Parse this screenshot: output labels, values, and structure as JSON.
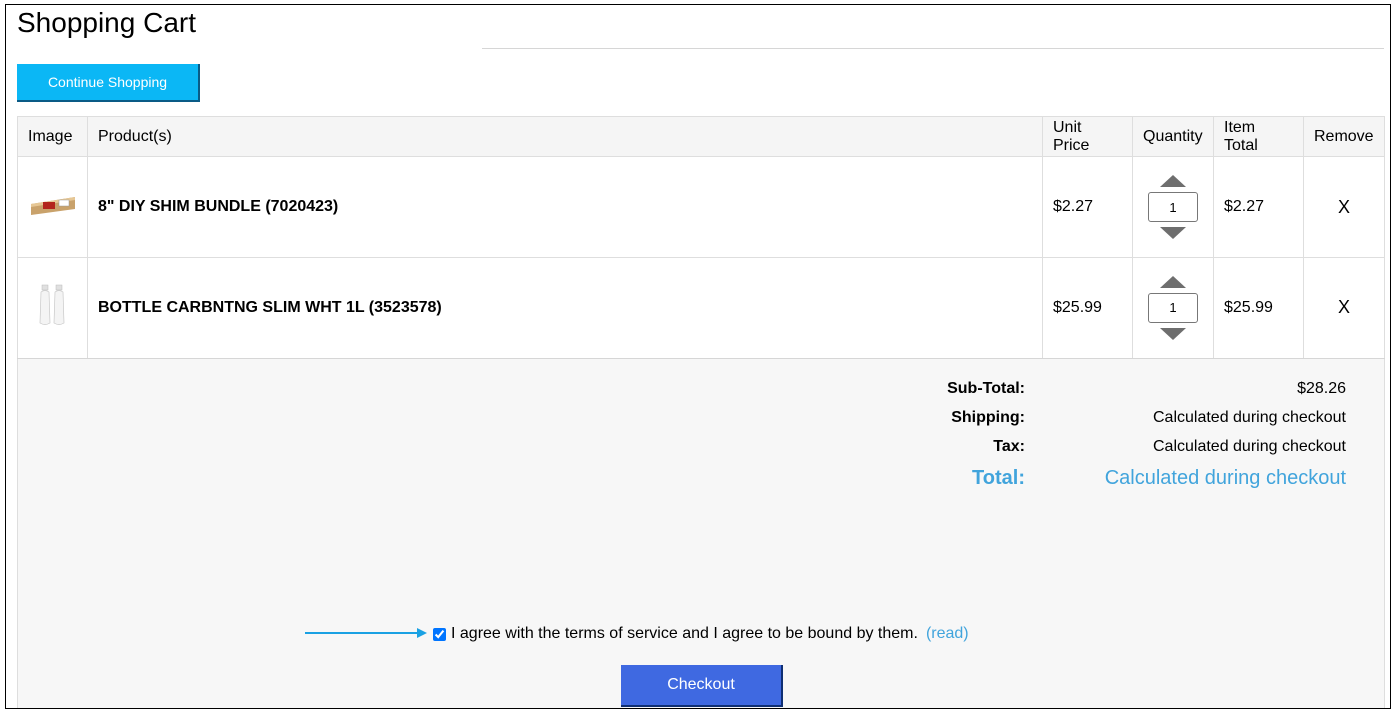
{
  "page": {
    "title": "Shopping Cart"
  },
  "actions": {
    "continue_label": "Continue Shopping",
    "checkout_label": "Checkout"
  },
  "table": {
    "headers": {
      "image": "Image",
      "product": "Product(s)",
      "unit_price": "Unit Price",
      "quantity": "Quantity",
      "item_total": "Item Total",
      "remove": "Remove"
    },
    "rows": [
      {
        "name": "8\" DIY SHIM BUNDLE (7020423)",
        "unit_price": "$2.27",
        "quantity": "1",
        "item_total": "$2.27",
        "remove": "X",
        "image_icon": "shim-bundle-thumbnail"
      },
      {
        "name": "BOTTLE CARBNTNG SLIM WHT 1L (3523578)",
        "unit_price": "$25.99",
        "quantity": "1",
        "item_total": "$25.99",
        "remove": "X",
        "image_icon": "bottles-thumbnail"
      }
    ]
  },
  "summary": {
    "subtotal_label": "Sub-Total:",
    "subtotal_value": "$28.26",
    "shipping_label": "Shipping:",
    "shipping_value": "Calculated during checkout",
    "tax_label": "Tax:",
    "tax_value": "Calculated during checkout",
    "total_label": "Total:",
    "total_value": "Calculated during checkout"
  },
  "terms": {
    "text": "I agree with the terms of service and I agree to be bound by them.",
    "read_label": "(read)",
    "checked": true
  },
  "colors": {
    "continue_button": "#0bb7f5",
    "checkout_button": "#3f69e1",
    "accent_total": "#41a4dc",
    "annotation_arrow": "#1aa1e3"
  }
}
